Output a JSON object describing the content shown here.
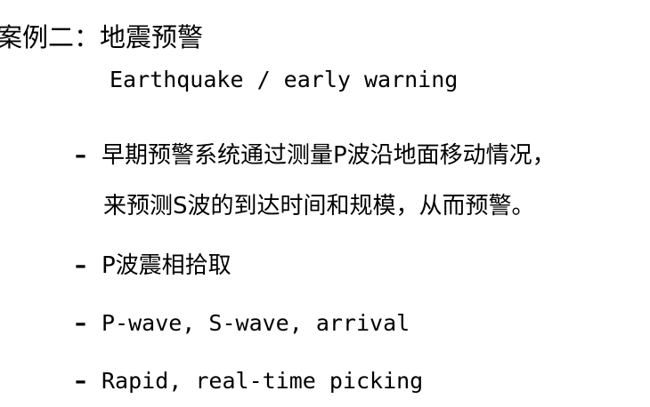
{
  "slide": {
    "title_zh": "案例二：地震预警",
    "title_en": "Earthquake / early warning",
    "bullets": [
      {
        "dash": "–",
        "line1": "早期预警系统通过测量P波沿地面移动情况，",
        "line2": "来预测S波的到达时间和规模，从而预警。"
      },
      {
        "dash": "–",
        "text": "P波震相拾取"
      },
      {
        "dash": "–",
        "text": "P-wave, S-wave, arrival"
      },
      {
        "dash": "–",
        "text": "Rapid, real-time picking"
      }
    ]
  }
}
